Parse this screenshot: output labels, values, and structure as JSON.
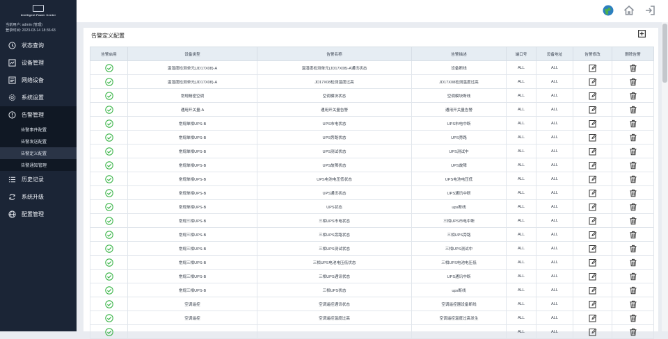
{
  "brand": {
    "name": "Intelligent Power Center"
  },
  "user": {
    "login_line": "当前用户: admin (管理)",
    "time_line": "登录时间: 2023-03-14 18:36:43"
  },
  "nav": {
    "status": "状态查询",
    "devices": "设备管理",
    "network": "网络设备",
    "system": "系统设置",
    "alarm": "告警管理",
    "sub": {
      "event": "告警事件配置",
      "send": "告警发送配置",
      "define": "告警定义配置",
      "notify": "告警通知管理"
    },
    "history": "历史记录",
    "upgrade": "系统升级",
    "config": "配置管理"
  },
  "page": {
    "title": "告警定义配置"
  },
  "table": {
    "headers": [
      "告警启用",
      "设备类型",
      "告警名称",
      "告警描述",
      "端口号",
      "设备地址",
      "告警修改",
      "删除告警"
    ],
    "rows": [
      [
        "温湿度检测单元(JD17X08)-A",
        "温湿度检测单元(JD17X08)-A通讯状态",
        "设备断线",
        "ALL",
        "ALL"
      ],
      [
        "温湿度检测单元(JD17X08)-A",
        "JD17X08检测温度过高",
        "JD17X08检测温度过高",
        "ALL",
        "ALL"
      ],
      [
        "常规精密空调",
        "空调模块状态",
        "空调模块断线",
        "ALL",
        "ALL"
      ],
      [
        "通用开关量-A",
        "通用开关量告警",
        "通用开关量告警",
        "ALL",
        "ALL"
      ],
      [
        "常规单相UPS-B",
        "UPS市电状态",
        "UPS市电中断",
        "ALL",
        "ALL"
      ],
      [
        "常规单相UPS-B",
        "UPS旁路状态",
        "UPS旁路",
        "ALL",
        "ALL"
      ],
      [
        "常规单相UPS-B",
        "UPS测试状态",
        "UPS测试中",
        "ALL",
        "ALL"
      ],
      [
        "常规单相UPS-B",
        "UPS故障状态",
        "UPS故障",
        "ALL",
        "ALL"
      ],
      [
        "常规单相UPS-B",
        "UPS电池电压低状态",
        "UPS电池电压低",
        "ALL",
        "ALL"
      ],
      [
        "常规单相UPS-B",
        "UPS通讯状态",
        "UPS通讯中断",
        "ALL",
        "ALL"
      ],
      [
        "常规单相UPS-B",
        "UPS状态",
        "ups断线",
        "ALL",
        "ALL"
      ],
      [
        "常规三相UPS-B",
        "三相UPS市电状态",
        "三相UPS市电中断",
        "ALL",
        "ALL"
      ],
      [
        "常规三相UPS-B",
        "三相UPS旁路状态",
        "三相UPS旁路",
        "ALL",
        "ALL"
      ],
      [
        "常规三相UPS-B",
        "三相UPS测试状态",
        "三相UPS测试中",
        "ALL",
        "ALL"
      ],
      [
        "常规三相UPS-B",
        "三相UPS电池电压低状态",
        "三相UPS电池电压低",
        "ALL",
        "ALL"
      ],
      [
        "常规三相UPS-B",
        "三相UPS通讯状态",
        "UPS通讯中断",
        "ALL",
        "ALL"
      ],
      [
        "常规三相UPS-B",
        "三相UPS状态",
        "ups断线",
        "ALL",
        "ALL"
      ],
      [
        "空调遥控",
        "空调遥控通讯状态",
        "空调遥控器设备断线",
        "ALL",
        "ALL"
      ],
      [
        "空调遥控",
        "空调遥控温度过高",
        "空调遥控温度过高发生",
        "ALL",
        "ALL"
      ],
      [
        "",
        "",
        "",
        "ALL",
        "ALL"
      ]
    ]
  },
  "colors": {
    "sidebar": "#1b2536",
    "ok_green": "#3cb54a",
    "header_bg": "#e6edf3"
  },
  "icons": {
    "enabled": "check-circle-icon",
    "edit": "edit-icon",
    "delete": "trash-icon",
    "add": "add-square-icon"
  }
}
